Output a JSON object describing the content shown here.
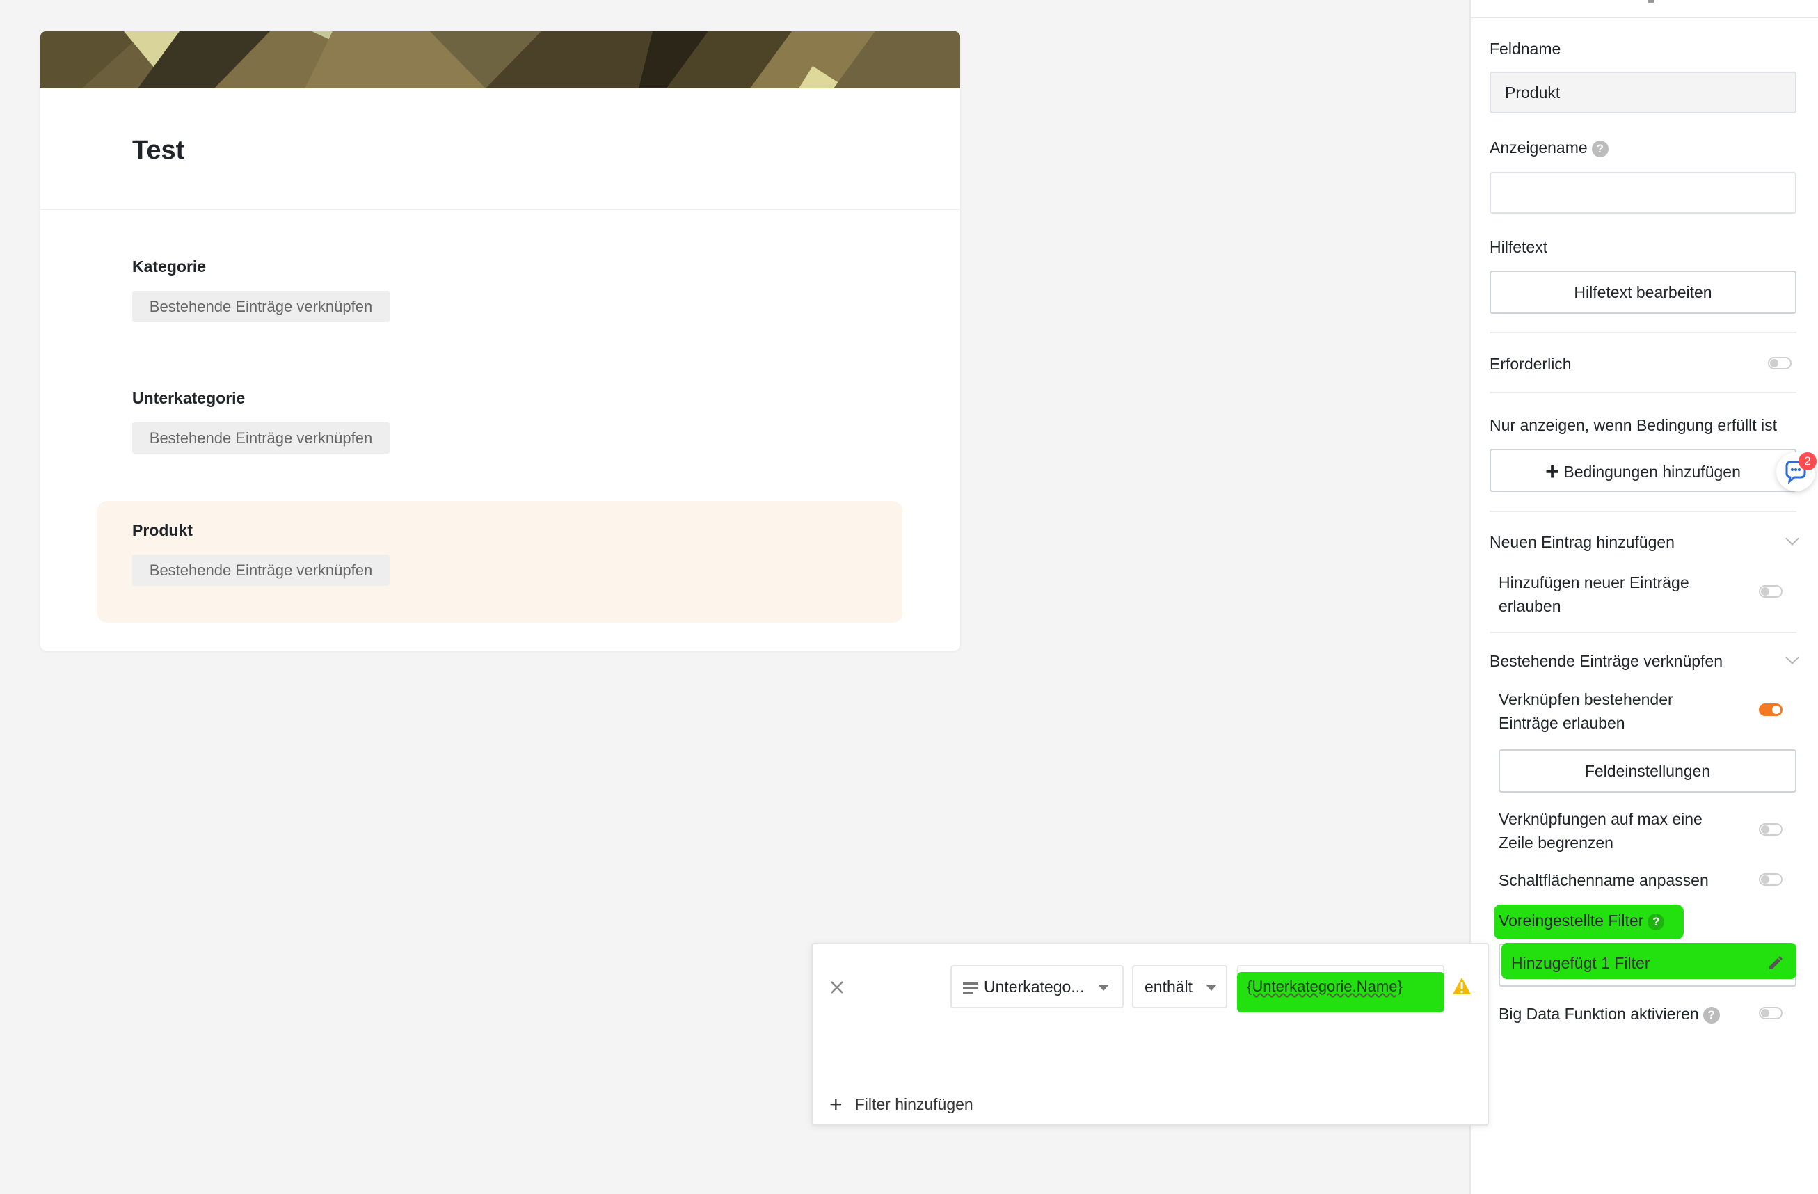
{
  "form": {
    "title": "Test",
    "fields": [
      {
        "label": "Kategorie",
        "button": "Bestehende Einträge verknüpfen"
      },
      {
        "label": "Unterkategorie",
        "button": "Bestehende Einträge verknüpfen"
      },
      {
        "label": "Produkt",
        "button": "Bestehende Einträge verknüpfen",
        "selected": true
      }
    ]
  },
  "sidebar": {
    "field_name_label": "Feldname",
    "field_name_value": "Produkt",
    "display_name_label": "Anzeigename",
    "display_name_value": "",
    "help_text_label": "Hilfetext",
    "help_text_button": "Hilfetext bearbeiten",
    "required_label": "Erforderlich",
    "required_on": false,
    "condition_label": "Nur anzeigen, wenn Bedingung erfüllt ist",
    "condition_button": "Bedingungen hinzufügen",
    "new_entry_section": "Neuen Eintrag hinzufügen",
    "allow_new_label": "Hinzufügen neuer Einträge erlauben",
    "allow_new_on": false,
    "link_section": "Bestehende Einträge verknüpfen",
    "allow_link_label": "Verknüpfen bestehender Einträge erlauben",
    "allow_link_on": true,
    "field_settings_button": "Feldeinstellungen",
    "limit_label": "Verknüpfungen auf max eine Zeile begrenzen",
    "limit_on": false,
    "button_name_label": "Schaltflächenname anpassen",
    "button_name_on": false,
    "preset_filter_label": "Voreingestellte Filter",
    "preset_filter_value": "Hinzugefügt 1 Filter",
    "big_data_label": "Big Data Funktion aktivieren",
    "big_data_on": false,
    "chat_badge_count": "2"
  },
  "filter_popup": {
    "column": "Unterkatego...",
    "operator": "enthält",
    "value": "{Unterkategorie.Name}",
    "add_filter": "Filter hinzufügen"
  },
  "colors": {
    "accent_orange": "#f47921",
    "highlight_green": "#22e10f",
    "selected_field_bg": "#fdf5ec",
    "warning_yellow": "#f5b800"
  }
}
